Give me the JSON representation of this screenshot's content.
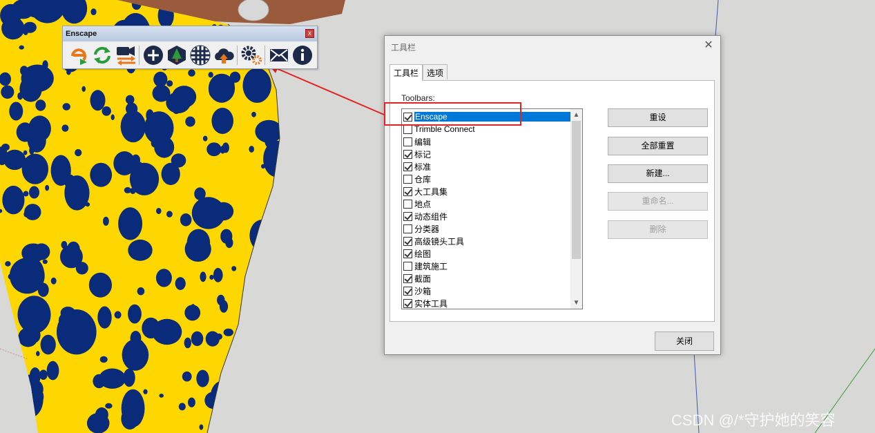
{
  "enscape_toolbar": {
    "title": "Enscape",
    "close_glyph": "x",
    "icons": [
      "enscape-logo-icon",
      "refresh-sync-icon",
      "video-camera-icon",
      "export-arrows-icon",
      "add-circle-icon",
      "tree-asset-icon",
      "material-sphere-icon",
      "cloud-upload-icon",
      "settings-gears-icon",
      "mail-envelope-icon",
      "info-icon"
    ],
    "colors": {
      "orange": "#e8761a",
      "green": "#2a9c3c",
      "navy": "#1e2a4a"
    }
  },
  "dialog": {
    "title": "工具栏",
    "close_glyph": "✕",
    "tabs": [
      {
        "label": "工具栏",
        "active": true
      },
      {
        "label": "选项",
        "active": false
      }
    ],
    "toolbars_label": "Toolbars:",
    "items": [
      {
        "label": "Enscape",
        "checked": true,
        "selected": true
      },
      {
        "label": "Trimble Connect",
        "checked": false
      },
      {
        "label": "编辑",
        "checked": false
      },
      {
        "label": "标记",
        "checked": true
      },
      {
        "label": "标准",
        "checked": true
      },
      {
        "label": "仓库",
        "checked": false
      },
      {
        "label": "大工具集",
        "checked": true
      },
      {
        "label": "地点",
        "checked": false
      },
      {
        "label": "动态组件",
        "checked": true
      },
      {
        "label": "分类器",
        "checked": false
      },
      {
        "label": "高级镜头工具",
        "checked": true
      },
      {
        "label": "绘图",
        "checked": true
      },
      {
        "label": "建筑施工",
        "checked": false
      },
      {
        "label": "截面",
        "checked": true
      },
      {
        "label": "沙箱",
        "checked": true
      },
      {
        "label": "实体工具",
        "checked": true
      }
    ],
    "buttons": {
      "reset": "重设",
      "reset_all": "全部重置",
      "new": "新建...",
      "rename": "重命名...",
      "delete": "删除",
      "close": "关闭"
    },
    "selection_color": "#0078d7"
  },
  "annotation_color": "#e52222",
  "background_colors": {
    "yellow": "#ffd700",
    "blue": "#0a2a7a",
    "skin": "#9a5a3c"
  },
  "watermark": "CSDN @/*守护她的笑容"
}
